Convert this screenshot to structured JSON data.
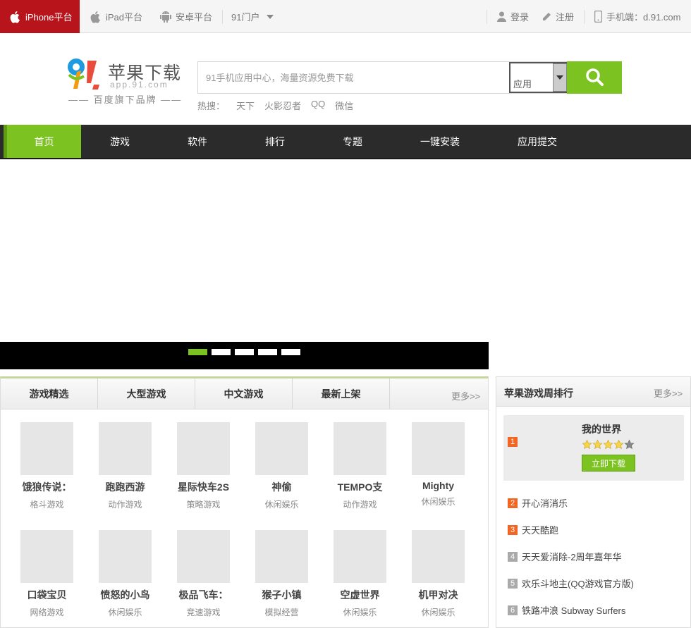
{
  "topbar": {
    "iphone": "iPhone平台",
    "ipad": "iPad平台",
    "android": "安卓平台",
    "portal": "91门户",
    "login": "登录",
    "register": "注册",
    "mobile": "手机端：d.91.com"
  },
  "logo": {
    "title": "苹果下载",
    "domain": "app.91.com",
    "tagline": "—— 百度旗下品牌 ——"
  },
  "search": {
    "placeholder": "91手机应用中心，海量资源免费下载",
    "select_value": "应用"
  },
  "hot": {
    "label": "热搜：",
    "terms": [
      "天下",
      "火影忍者",
      "QQ",
      "微信"
    ]
  },
  "nav": [
    "首页",
    "游戏",
    "软件",
    "排行",
    "专题",
    "一键安装",
    "应用提交"
  ],
  "panel": {
    "tabs": [
      "游戏精选",
      "大型游戏",
      "中文游戏",
      "最新上架"
    ],
    "more": "更多>>",
    "apps": [
      {
        "name": "饿狼传说：",
        "cat": "格斗游戏"
      },
      {
        "name": "跑跑西游",
        "cat": "动作游戏"
      },
      {
        "name": "星际快车2S",
        "cat": "策略游戏"
      },
      {
        "name": "神偷",
        "cat": "休闲娱乐"
      },
      {
        "name": "TEMPO支",
        "cat": "动作游戏"
      },
      {
        "name": "Mighty",
        "cat": "休闲娱乐"
      },
      {
        "name": "口袋宝贝",
        "cat": "网络游戏"
      },
      {
        "name": "愤怒的小鸟",
        "cat": "休闲娱乐"
      },
      {
        "name": "极品飞车：",
        "cat": "竞速游戏"
      },
      {
        "name": "猴子小镇",
        "cat": "模拟经营"
      },
      {
        "name": "空虚世界",
        "cat": "休闲娱乐"
      },
      {
        "name": "机甲对决",
        "cat": "休闲娱乐"
      }
    ]
  },
  "ranking": {
    "title": "苹果游戏周排行",
    "more": "更多>>",
    "top": {
      "num": "1",
      "name": "我的世界",
      "rating": 4,
      "download": "立即下载"
    },
    "rows": [
      {
        "num": "2",
        "name": "开心消消乐"
      },
      {
        "num": "3",
        "name": "天天酷跑"
      },
      {
        "num": "4",
        "name": "天天爱消除-2周年嘉年华"
      },
      {
        "num": "5",
        "name": "欢乐斗地主(QQ游戏官方版)"
      },
      {
        "num": "6",
        "name": "铁路冲浪 Subway Surfers"
      }
    ]
  },
  "colors": {
    "brand_red": "#b8141b",
    "accent_green": "#7cc322",
    "nav_bg": "#2b2b2b",
    "rank_hot": "#f26522"
  }
}
